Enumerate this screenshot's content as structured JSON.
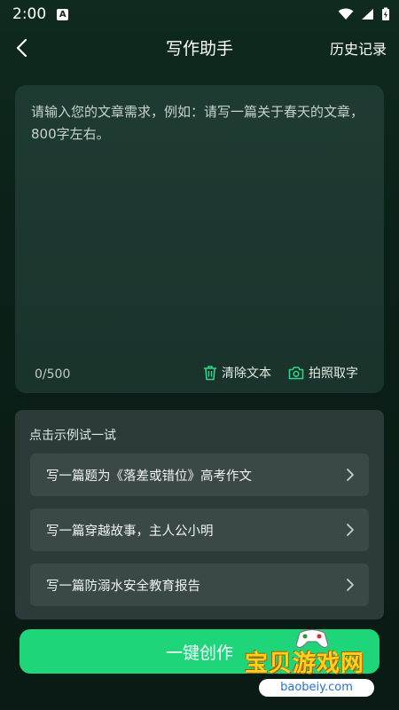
{
  "status_bar": {
    "time": "2:00",
    "notification_badge": "A"
  },
  "header": {
    "title": "写作助手",
    "history_label": "历史记录"
  },
  "editor": {
    "placeholder": "请输入您的文章需求，例如：请写一篇关于春天的文章，800字左右。",
    "char_count": "0/500",
    "clear_label": "清除文本",
    "photo_label": "拍照取字"
  },
  "examples": {
    "title": "点击示例试一试",
    "items": [
      {
        "label": "写一篇题为《落差或错位》高考作文"
      },
      {
        "label": "写一篇穿越故事，主人公小明"
      },
      {
        "label": "写一篇防溺水安全教育报告"
      }
    ]
  },
  "action": {
    "create_label": "一键创作"
  },
  "watermark": {
    "brand": "宝贝游戏网",
    "url": "baobeiy.com"
  },
  "colors": {
    "accent": "#1ed57a",
    "background": "#0b2018",
    "card": "#2c3a3a"
  }
}
